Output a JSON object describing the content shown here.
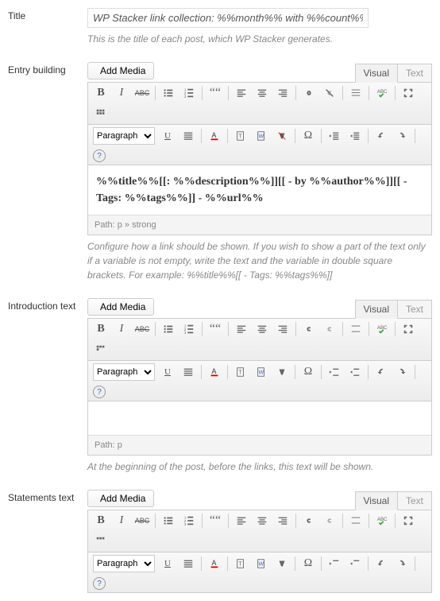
{
  "title": {
    "label": "Title",
    "value": "WP Stacker link collection: %%month%% with %%count%% link",
    "desc": "This is the title of each post, which WP Stacker generates."
  },
  "entry": {
    "label": "Entry building",
    "add_media": "Add Media",
    "tab_visual": "Visual",
    "tab_text": "Text",
    "paragraph": "Paragraph",
    "content": "%%title%%[[: %%description%%]][[ - by %%author%%]][[ - Tags: %%tags%%]] - %%url%%",
    "path": "Path: p » strong",
    "desc": "Configure how a link should be shown. If you wish to show a part of the text only if a variable is not empty, write the text and the variable in double square brackets. For example: %%title%%[[ - Tags: %%tags%%]]"
  },
  "intro": {
    "label": "Introduction text",
    "add_media": "Add Media",
    "tab_visual": "Visual",
    "tab_text": "Text",
    "paragraph": "Paragraph",
    "content": "",
    "path": "Path: p",
    "desc": "At the beginning of the post, before the links, this text will be shown."
  },
  "statements": {
    "label": "Statements text",
    "add_media": "Add Media",
    "tab_visual": "Visual",
    "tab_text": "Text",
    "paragraph": "Paragraph"
  },
  "icons": {
    "bold": "B",
    "italic": "I",
    "strike": "ABC",
    "underline": "U",
    "help": "?"
  }
}
